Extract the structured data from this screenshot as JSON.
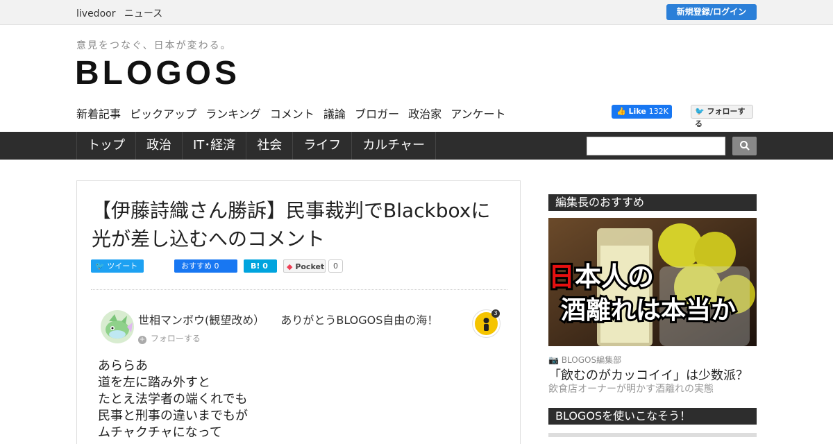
{
  "topbar": {
    "brand": [
      "livedoor",
      "ニュース"
    ],
    "login_label": "新規登録/ログイン"
  },
  "tagline": "意見をつなぐ、日本が変わる。",
  "logo": "BLOGOS",
  "subnav": [
    "新着記事",
    "ピックアップ",
    "ランキング",
    "コメント",
    "議論",
    "ブロガー",
    "政治家",
    "アンケート"
  ],
  "fb_like": {
    "label": "Like",
    "count": "132K"
  },
  "tw_follow": "フォローする",
  "mainnav": [
    "トップ",
    "政治",
    "IT･経済",
    "社会",
    "ライフ",
    "カルチャー"
  ],
  "search": {
    "placeholder": "",
    "icon": "search-icon"
  },
  "article": {
    "title": "【伊藤詩織さん勝訴】民事裁判でBlackboxに光が差し込むへのコメント",
    "share": {
      "tweet": "ツイート",
      "fb": "おすすめ 0",
      "hatena": "B!  0",
      "pocket": "Pocket",
      "pocket_count": "0"
    },
    "comment": {
      "author": "世相マンボウ(観望改め）",
      "message": "ありがとうBLOGOS自由の海！",
      "follow": "フォローする",
      "badge_count": "3",
      "lines": [
        "あららあ",
        "道を左に踏み外すと",
        "たとえ法学者の端くれでも",
        "民事と刑事の違いまでもが",
        "ムチャクチャになって"
      ]
    }
  },
  "sidebar": {
    "editor_pick_head": "編集長のおすすめ",
    "hero_text": [
      "日本人の",
      "酒離れは本当か"
    ],
    "hero_source": "BLOGOS編集部",
    "hero_title": "「飲むのがカッコイイ」は少数派？",
    "hero_sub": "飲食店オーナーが明かす酒離れの実態",
    "use_head": "BLOGOSを使いこなそう！"
  },
  "colors": {
    "accent_blue": "#2b7fd8",
    "nav_bg": "#2d2d2d",
    "fb_blue": "#1877f2",
    "twitter_blue": "#1da1f2"
  }
}
